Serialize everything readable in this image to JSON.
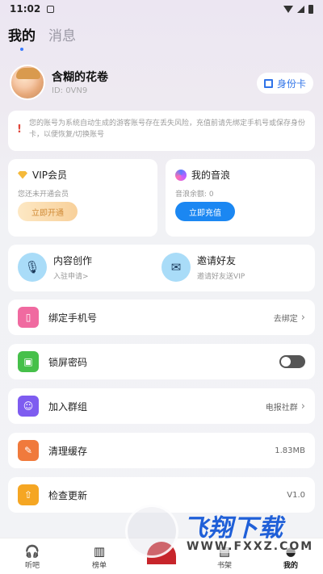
{
  "status_bar": {
    "time": "11:02"
  },
  "tabs": [
    {
      "label": "我的"
    },
    {
      "label": "消息"
    }
  ],
  "profile": {
    "nickname": "含糊的花卷",
    "user_id": "ID: 0VN9",
    "id_card_label": "身份卡"
  },
  "warning": {
    "text": "您的账号为系统自动生成的游客账号存在丢失风险，充值前请先绑定手机号或保存身份卡，以便恢复/切换账号"
  },
  "vip": {
    "title": "VIP会员",
    "subtitle": "您还未开通会员",
    "button": "立即开通"
  },
  "wave": {
    "title": "我的音浪",
    "subtitle": "音浪余额: 0",
    "button": "立即充值"
  },
  "create": [
    {
      "title": "内容创作",
      "subtitle": "入驻申请>"
    },
    {
      "title": "邀请好友",
      "subtitle": "邀请好友送VIP"
    }
  ],
  "menu": {
    "bind_phone": {
      "label": "绑定手机号",
      "value": "去绑定",
      "color": "#f06aa0"
    },
    "lock_password": {
      "label": "锁屏密码",
      "color": "#46c04a"
    },
    "join_group": {
      "label": "加入群组",
      "value": "电报社群",
      "color": "#7e5cf0"
    },
    "clear_cache": {
      "label": "清理缓存",
      "value": "1.83MB",
      "color": "#f07a3c"
    },
    "check_update": {
      "label": "检查更新",
      "value": "V1.0",
      "color": "#f5a623"
    }
  },
  "bottom_nav": [
    {
      "label": "听吧"
    },
    {
      "label": "榜单"
    },
    {
      "label": ""
    },
    {
      "label": "书架"
    },
    {
      "label": "我的"
    }
  ],
  "watermark": {
    "text": "飞翔下载",
    "url": "WWW.FXXZ.COM"
  }
}
